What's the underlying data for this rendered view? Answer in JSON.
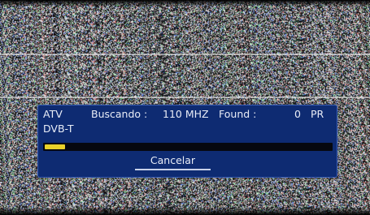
{
  "scan_dialog": {
    "mode": "ATV",
    "searching_label": "Buscando :",
    "frequency": "110 MHZ",
    "found_label": "Found :",
    "found_count": "0",
    "pr_label": "PR",
    "second_mode": "DVB-T",
    "progress_fraction": 0.07,
    "cancel_label": "Cancelar"
  },
  "colors": {
    "dialog_bg": "#0e2b72",
    "progress_fill": "#e9d12a"
  }
}
